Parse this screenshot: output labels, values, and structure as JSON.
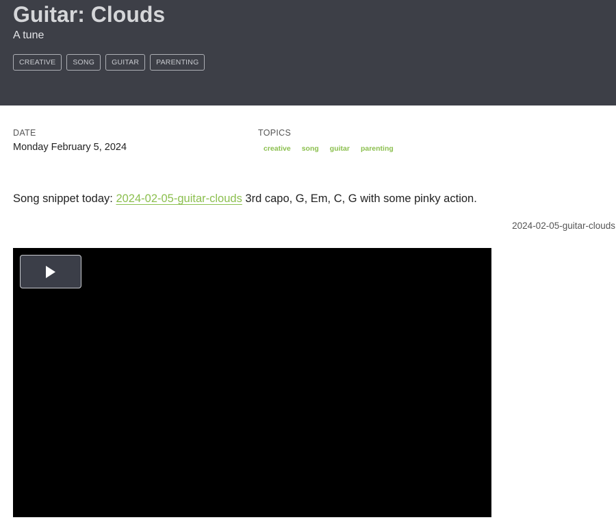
{
  "header": {
    "title": "Guitar: Clouds",
    "subtitle": "A tune",
    "tags": [
      "CREATIVE",
      "SONG",
      "GUITAR",
      "PARENTING"
    ]
  },
  "meta": {
    "date_label": "DATE",
    "date_value": "Monday February 5, 2024",
    "topics_label": "TOPICS",
    "topics": [
      "creative",
      "song",
      "guitar",
      "parenting"
    ]
  },
  "content": {
    "intro": "Song snippet today: ",
    "link_text": "2024-02-05-guitar-clouds",
    "after_link": " 3rd capo, G, Em, C, G with some pinky action.",
    "caption": "2024-02-05-guitar-clouds"
  },
  "video": {
    "play_icon": "play-icon"
  },
  "colors": {
    "header_bg": "#3d3f47",
    "accent_green": "#8bbf4e",
    "video_bg": "#000000"
  }
}
